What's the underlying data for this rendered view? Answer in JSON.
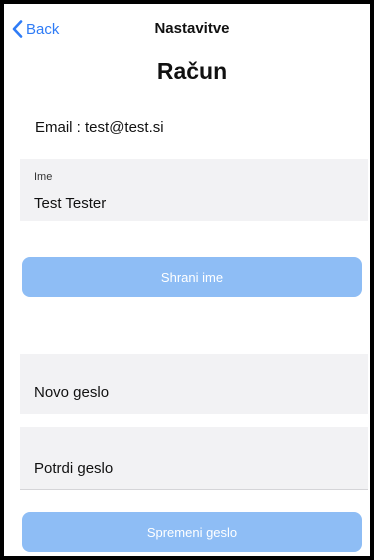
{
  "nav": {
    "back_label": "Back",
    "title": "Nastavitve"
  },
  "page": {
    "title": "Račun"
  },
  "account": {
    "email_label": "Email :",
    "email_value": "test@test.si"
  },
  "name_field": {
    "label": "Ime",
    "value": "Test Tester"
  },
  "buttons": {
    "save_name": "Shrani ime",
    "change_password": "Spremeni geslo"
  },
  "password": {
    "new_placeholder": "Novo geslo",
    "confirm_placeholder": "Potrdi geslo"
  },
  "colors": {
    "accent": "#2f7cf6",
    "button_disabled": "#8ebdf5",
    "field_bg": "#f2f2f4"
  }
}
